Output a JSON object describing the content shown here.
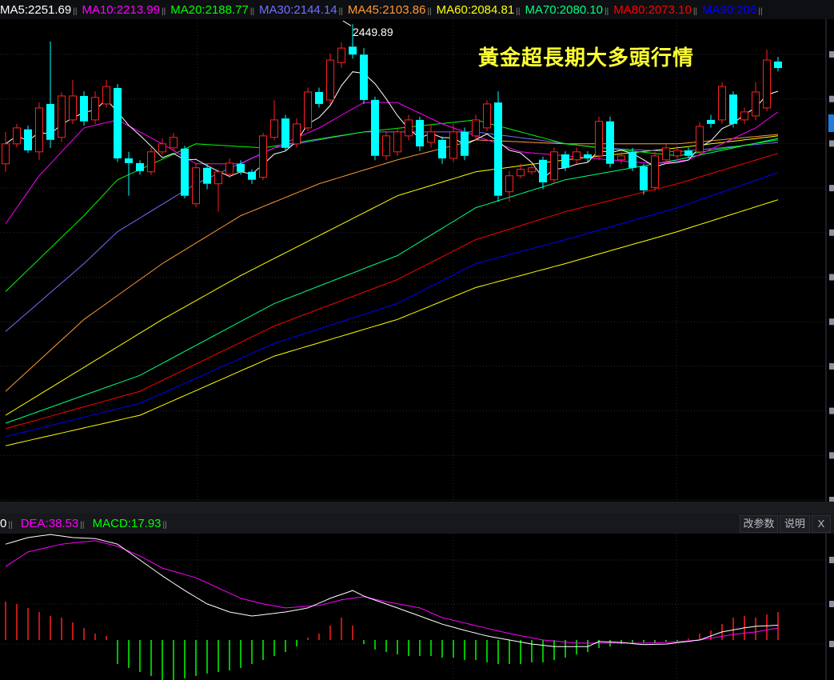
{
  "legend": [
    {
      "label": "MA5:",
      "value": "2251.69",
      "color": "#ffffff"
    },
    {
      "label": "MA10:",
      "value": "2213.99",
      "color": "#ff00ff"
    },
    {
      "label": "MA20:",
      "value": "2188.77",
      "color": "#00ff00"
    },
    {
      "label": "MA30:",
      "value": "2144.14",
      "color": "#7070ff"
    },
    {
      "label": "MA45:",
      "value": "2103.86",
      "color": "#ff9933"
    },
    {
      "label": "MA60:",
      "value": "2084.81",
      "color": "#ffff00"
    },
    {
      "label": "MA70:",
      "value": "2080.10",
      "color": "#00ff80"
    },
    {
      "label": "MA80:",
      "value": "2073.10",
      "color": "#ff0000"
    },
    {
      "label": "MA90:",
      "value": "206",
      "color": "#0000ff"
    }
  ],
  "annotation_title": "黃金超長期大多頭行情",
  "high_label": "2449.89",
  "macd_header": {
    "dif_fragment": "0",
    "dea": "DEA:38.53",
    "macd": "MACD:17.93",
    "buttons": [
      "改参数",
      "说明",
      "X"
    ]
  },
  "colors": {
    "up": "#ff2020",
    "down": "#00ffff",
    "dif": "#ffffff",
    "dea": "#ff00ff",
    "hist_up": "#ff2020",
    "hist_down": "#00ff00"
  },
  "chart_data": {
    "type": "candlestick",
    "ylim": [
      1134,
      2468
    ],
    "grid": true,
    "ohlc": [
      [
        2065,
        2153,
        2043,
        2120
      ],
      [
        2120,
        2175,
        2110,
        2164
      ],
      [
        2160,
        2170,
        2095,
        2102
      ],
      [
        2098,
        2234,
        2076,
        2219
      ],
      [
        2230,
        2402,
        2109,
        2131
      ],
      [
        2138,
        2262,
        2125,
        2252
      ],
      [
        2186,
        2296,
        2175,
        2252
      ],
      [
        2252,
        2265,
        2170,
        2182
      ],
      [
        2186,
        2265,
        2175,
        2248
      ],
      [
        2230,
        2296,
        2220,
        2278
      ],
      [
        2274,
        2285,
        2070,
        2080
      ],
      [
        2080,
        2098,
        1977,
        2067
      ],
      [
        2067,
        2075,
        2035,
        2045
      ],
      [
        2043,
        2110,
        2035,
        2098
      ],
      [
        2098,
        2135,
        2090,
        2120
      ],
      [
        2109,
        2150,
        2100,
        2138
      ],
      [
        2107,
        2115,
        1970,
        1977
      ],
      [
        1955,
        2065,
        1945,
        2054
      ],
      [
        2054,
        2065,
        1995,
        2010
      ],
      [
        2010,
        2050,
        1933,
        2043
      ],
      [
        2036,
        2080,
        2025,
        2067
      ],
      [
        2065,
        2075,
        2035,
        2043
      ],
      [
        2043,
        2050,
        2010,
        2021
      ],
      [
        2028,
        2150,
        2020,
        2142
      ],
      [
        2138,
        2240,
        2130,
        2186
      ],
      [
        2190,
        2200,
        2100,
        2109
      ],
      [
        2120,
        2190,
        2110,
        2175
      ],
      [
        2164,
        2275,
        2155,
        2263
      ],
      [
        2263,
        2275,
        2220,
        2230
      ],
      [
        2241,
        2370,
        2230,
        2351
      ],
      [
        2344,
        2400,
        2330,
        2384
      ],
      [
        2388,
        2449.89,
        2355,
        2366
      ],
      [
        2366,
        2384,
        2230,
        2241
      ],
      [
        2241,
        2250,
        2075,
        2087
      ],
      [
        2087,
        2155,
        2075,
        2142
      ],
      [
        2098,
        2165,
        2087,
        2153
      ],
      [
        2142,
        2200,
        2130,
        2186
      ],
      [
        2186,
        2195,
        2100,
        2113
      ],
      [
        2124,
        2175,
        2110,
        2153
      ],
      [
        2131,
        2140,
        2065,
        2080
      ],
      [
        2080,
        2175,
        2070,
        2153
      ],
      [
        2153,
        2165,
        2075,
        2087
      ],
      [
        2142,
        2200,
        2130,
        2186
      ],
      [
        2164,
        2240,
        2155,
        2230
      ],
      [
        2234,
        2265,
        1960,
        1977
      ],
      [
        1988,
        2045,
        1960,
        2032
      ],
      [
        2032,
        2065,
        2025,
        2050
      ],
      [
        2043,
        2065,
        2035,
        2054
      ],
      [
        2076,
        2085,
        1995,
        2014
      ],
      [
        2021,
        2110,
        2010,
        2098
      ],
      [
        2091,
        2100,
        2045,
        2054
      ],
      [
        2076,
        2110,
        2065,
        2098
      ],
      [
        2091,
        2100,
        2070,
        2080
      ],
      [
        2087,
        2195,
        2075,
        2182
      ],
      [
        2182,
        2195,
        2055,
        2065
      ],
      [
        2076,
        2098,
        2065,
        2087
      ],
      [
        2098,
        2109,
        2045,
        2054
      ],
      [
        2058,
        2065,
        1980,
        1992
      ],
      [
        2000,
        2098,
        1990,
        2087
      ],
      [
        2076,
        2120,
        2065,
        2109
      ],
      [
        2087,
        2115,
        2080,
        2102
      ],
      [
        2102,
        2110,
        2080,
        2087
      ],
      [
        2098,
        2180,
        2087,
        2168
      ],
      [
        2186,
        2200,
        2165,
        2175
      ],
      [
        2186,
        2290,
        2175,
        2278
      ],
      [
        2256,
        2265,
        2165,
        2175
      ],
      [
        2186,
        2220,
        2175,
        2208
      ],
      [
        2197,
        2290,
        2185,
        2263
      ],
      [
        2219,
        2380,
        2210,
        2351
      ],
      [
        2347,
        2360,
        2320,
        2329
      ]
    ],
    "ohlc_order": [
      "open",
      "high",
      "low",
      "close"
    ],
    "ma_computed": [
      {
        "name": "MA5",
        "period": 5,
        "color": "#ffffff"
      }
    ],
    "ma_sampled": [
      {
        "name": "MA10",
        "color": "#ff00ff",
        "points": [
          [
            0,
            1900
          ],
          [
            3,
            2032
          ],
          [
            7,
            2164
          ],
          [
            10,
            2186
          ],
          [
            14,
            2120
          ],
          [
            17,
            2065
          ],
          [
            21,
            2065
          ],
          [
            24,
            2109
          ],
          [
            28,
            2164
          ],
          [
            32,
            2234
          ],
          [
            35,
            2234
          ],
          [
            39,
            2175
          ],
          [
            42,
            2142
          ],
          [
            46,
            2098
          ],
          [
            50,
            2087
          ],
          [
            54,
            2076
          ],
          [
            58,
            2065
          ],
          [
            61,
            2076
          ],
          [
            64,
            2120
          ],
          [
            67,
            2164
          ],
          [
            69,
            2208
          ]
        ]
      },
      {
        "name": "MA20",
        "color": "#00ff00",
        "points": [
          [
            0,
            1713
          ],
          [
            7,
            1922
          ],
          [
            10,
            2021
          ],
          [
            17,
            2120
          ],
          [
            23,
            2109
          ],
          [
            32,
            2153
          ],
          [
            42,
            2186
          ],
          [
            50,
            2120
          ],
          [
            60,
            2087
          ],
          [
            69,
            2131
          ]
        ]
      },
      {
        "name": "MA30",
        "color": "#7070ff",
        "points": [
          [
            0,
            1603
          ],
          [
            7,
            1790
          ],
          [
            10,
            1878
          ],
          [
            17,
            2010
          ],
          [
            24,
            2109
          ],
          [
            32,
            2153
          ],
          [
            42,
            2153
          ],
          [
            53,
            2109
          ],
          [
            60,
            2098
          ],
          [
            69,
            2124
          ]
        ]
      },
      {
        "name": "MA45",
        "color": "#ff9933",
        "points": [
          [
            0,
            1438
          ],
          [
            7,
            1636
          ],
          [
            14,
            1790
          ],
          [
            21,
            1922
          ],
          [
            28,
            2010
          ],
          [
            35,
            2076
          ],
          [
            42,
            2131
          ],
          [
            50,
            2120
          ],
          [
            60,
            2120
          ],
          [
            69,
            2146
          ]
        ]
      },
      {
        "name": "MA60",
        "color": "#ffff00",
        "points": [
          [
            0,
            1372
          ],
          [
            7,
            1504
          ],
          [
            14,
            1636
          ],
          [
            21,
            1757
          ],
          [
            28,
            1867
          ],
          [
            35,
            1977
          ],
          [
            42,
            2043
          ],
          [
            50,
            2076
          ],
          [
            60,
            2109
          ],
          [
            69,
            2142
          ]
        ]
      },
      {
        "name": "MA70",
        "color": "#00ff80",
        "points": [
          [
            0,
            1350
          ],
          [
            12,
            1482
          ],
          [
            24,
            1680
          ],
          [
            35,
            1812
          ],
          [
            42,
            1944
          ],
          [
            50,
            2021
          ],
          [
            60,
            2076
          ],
          [
            69,
            2135
          ]
        ]
      },
      {
        "name": "MA80",
        "color": "#ff0000",
        "points": [
          [
            0,
            1335
          ],
          [
            12,
            1438
          ],
          [
            24,
            1618
          ],
          [
            35,
            1746
          ],
          [
            42,
            1856
          ],
          [
            50,
            1933
          ],
          [
            60,
            2010
          ],
          [
            69,
            2094
          ]
        ]
      },
      {
        "name": "MA90",
        "color": "#0000ff",
        "points": [
          [
            0,
            1313
          ],
          [
            12,
            1405
          ],
          [
            24,
            1570
          ],
          [
            35,
            1680
          ],
          [
            42,
            1790
          ],
          [
            50,
            1856
          ],
          [
            60,
            1944
          ],
          [
            69,
            2041
          ]
        ]
      },
      {
        "name": "",
        "color": "#ffff00",
        "points": [
          [
            0,
            1288
          ],
          [
            12,
            1372
          ],
          [
            24,
            1535
          ],
          [
            35,
            1636
          ],
          [
            42,
            1724
          ],
          [
            50,
            1790
          ],
          [
            60,
            1878
          ],
          [
            69,
            1966
          ]
        ]
      }
    ],
    "macd": {
      "dif": [
        [
          0,
          308
        ],
        [
          2,
          329
        ],
        [
          4,
          339
        ],
        [
          6,
          329
        ],
        [
          8,
          326
        ],
        [
          10,
          308
        ],
        [
          12,
          257
        ],
        [
          14,
          206
        ],
        [
          16,
          159
        ],
        [
          18,
          116
        ],
        [
          20,
          90
        ],
        [
          22,
          77
        ],
        [
          25,
          90
        ],
        [
          27,
          103
        ],
        [
          29,
          134
        ],
        [
          31,
          159
        ],
        [
          32,
          141
        ],
        [
          35,
          103
        ],
        [
          37,
          77
        ],
        [
          39,
          51
        ],
        [
          41,
          31
        ],
        [
          43,
          13
        ],
        [
          45,
          0
        ],
        [
          47,
          -13
        ],
        [
          49,
          -21
        ],
        [
          52,
          -21
        ],
        [
          53,
          -5
        ],
        [
          55,
          -8
        ],
        [
          57,
          -15
        ],
        [
          59,
          -13
        ],
        [
          62,
          0
        ],
        [
          64,
          26
        ],
        [
          66,
          39
        ],
        [
          67,
          44
        ],
        [
          69,
          47.5
        ]
      ],
      "dea": [
        [
          0,
          236
        ],
        [
          2,
          283
        ],
        [
          5,
          308
        ],
        [
          8,
          319
        ],
        [
          10,
          301
        ],
        [
          12,
          270
        ],
        [
          14,
          231
        ],
        [
          17,
          200
        ],
        [
          19,
          167
        ],
        [
          21,
          134
        ],
        [
          23,
          116
        ],
        [
          25,
          103
        ],
        [
          28,
          111
        ],
        [
          30,
          129
        ],
        [
          32,
          139
        ],
        [
          34,
          123
        ],
        [
          37,
          103
        ],
        [
          39,
          72
        ],
        [
          42,
          46
        ],
        [
          45,
          21
        ],
        [
          48,
          0
        ],
        [
          51,
          -10
        ],
        [
          54,
          -10
        ],
        [
          57,
          -10
        ],
        [
          59,
          -8
        ],
        [
          62,
          0
        ],
        [
          65,
          18
        ],
        [
          67,
          26
        ],
        [
          69,
          38.53
        ]
      ],
      "hist": [
        24.6,
        23,
        20.5,
        17.9,
        15.4,
        14.3,
        11.3,
        7.7,
        4.1,
        2.6,
        -15.4,
        -17.9,
        -20.5,
        -23,
        -25.6,
        -25.6,
        -24.6,
        -23,
        -21.5,
        -20.5,
        -19.5,
        -17.9,
        -15.4,
        -12.8,
        -10.2,
        -7.7,
        -4.1,
        1.5,
        4.1,
        9.2,
        14.3,
        9.2,
        -2.6,
        -6.1,
        -7.7,
        -9.2,
        -10.2,
        -10.2,
        -10.2,
        -11.3,
        -11.3,
        -12.8,
        -12.8,
        -14.3,
        -15.4,
        -15.4,
        -15.4,
        -14.3,
        -14.3,
        -12.8,
        -11.3,
        -9.2,
        -7.7,
        -5.1,
        -4.1,
        -2.6,
        -2.6,
        -1.5,
        -1.5,
        -1,
        -1,
        1,
        4.1,
        6.1,
        10.2,
        14.3,
        15.4,
        14.3,
        16.4,
        17.93
      ]
    }
  }
}
